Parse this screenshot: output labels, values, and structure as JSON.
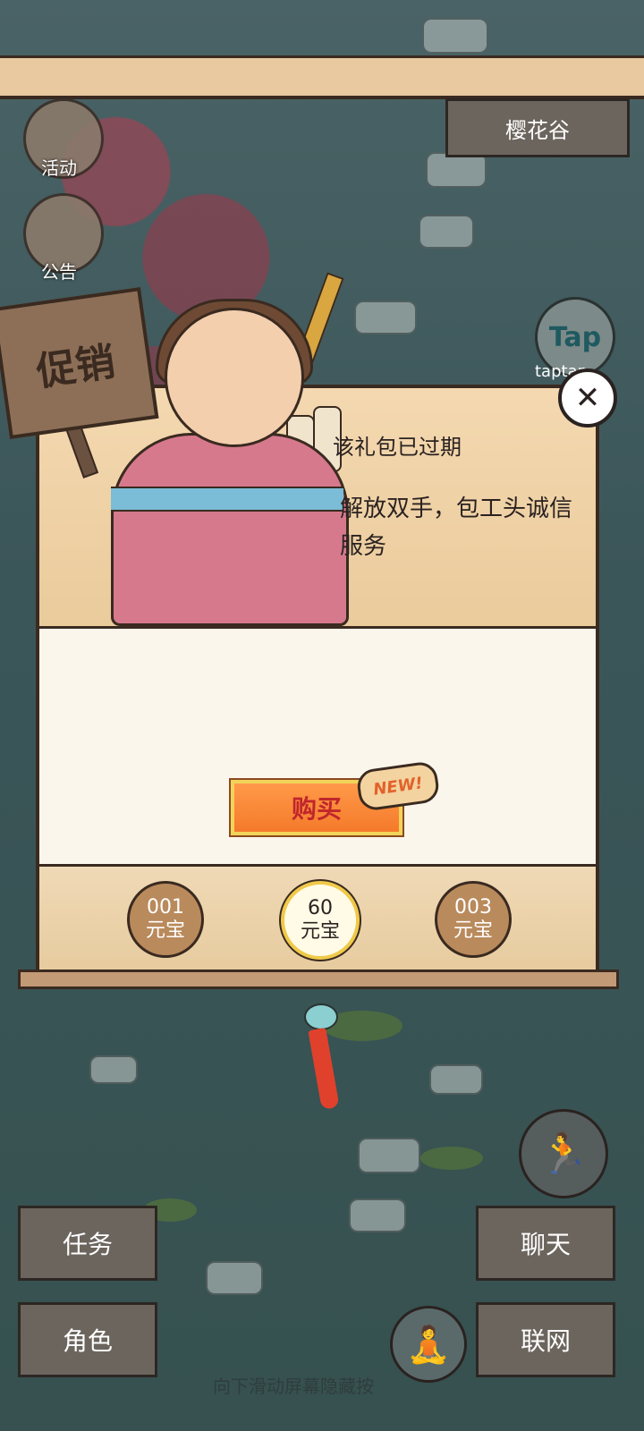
{
  "header": {
    "location": "樱花谷"
  },
  "side_menu": [
    {
      "label": "活动",
      "icon": "scroll-icon"
    },
    {
      "label": "公告",
      "icon": "gate-icon"
    }
  ],
  "taptap": {
    "logo_text": "Tap",
    "sub_text": "taptap"
  },
  "promo_sign": "促销",
  "dialog": {
    "title": "该礼包已过期",
    "description": "解放双手，包工头诚信服务",
    "buy_label": "购买",
    "new_badge": "NEW!",
    "options": [
      {
        "line1": "001",
        "line2": "元宝",
        "selected": false
      },
      {
        "line1": "60",
        "line2": "元宝",
        "selected": true
      },
      {
        "line1": "003",
        "line2": "元宝",
        "selected": false
      }
    ]
  },
  "bottom_buttons": {
    "task": "任务",
    "chat": "聊天",
    "role": "角色",
    "network": "联网"
  },
  "hint": "向下滑动屏幕隐藏按",
  "colors": {
    "buy_text": "#c0262b",
    "buy_bg": "#f47a2a",
    "panel_bg": "#fbf6ec",
    "water": "#3f5a5f"
  }
}
